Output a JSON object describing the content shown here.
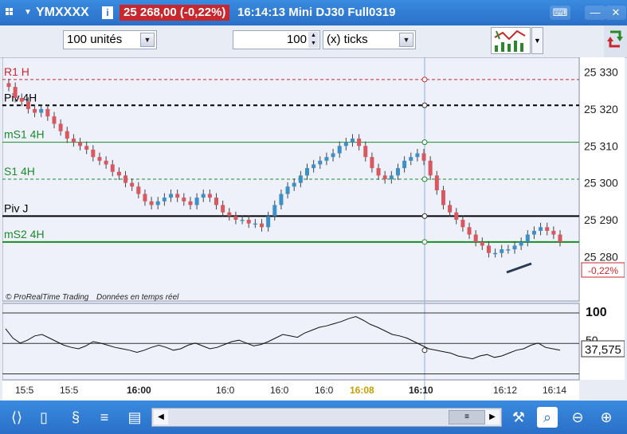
{
  "window": {
    "symbol": "YMXXXX",
    "price_badge": "25 268,00 (-0,22%)",
    "subtitle": "16:14:13 Mini DJ30 Full0319",
    "info_glyph": "i"
  },
  "toolbar": {
    "units_select": "100 unités",
    "ticks_value": "100",
    "ticks_unit_select": "(x) ticks"
  },
  "chart": {
    "levels": {
      "r1": "R1 H",
      "piv4": "Piv 4H",
      "ms1": "mS1 4H",
      "s1": "S1 4H",
      "pivj": "Piv J",
      "ms2": "mS2 4H"
    },
    "price_ticks": [
      "25 330",
      "25 320",
      "25 310",
      "25 300",
      "25 290",
      "25 280"
    ],
    "current_price_tag": "-0,22%",
    "credit_brand": "© ProRealTime Trading",
    "credit_note": "Données en temps réel",
    "indicator_top_label": "100",
    "indicator_mid_label": "50",
    "indicator_value": "37,575",
    "time_ticks": [
      "15:5",
      "15:5",
      "16:00",
      "16:0",
      "16:0",
      "16:0",
      "16:08",
      "16:10",
      "16:12",
      "16:14"
    ]
  },
  "colors": {
    "bull": "#3d8fc7",
    "bear": "#d9575e",
    "red_level": "#c8282d",
    "green_level": "#1a8a2a",
    "accent": "#2a6fc8"
  },
  "chart_data": {
    "type": "candlestick",
    "ylim": [
      25268,
      25334
    ],
    "price_ticks": [
      25330,
      25320,
      25310,
      25300,
      25290,
      25280
    ],
    "levels": [
      {
        "name": "R1 H",
        "value": 25328
      },
      {
        "name": "Piv 4H",
        "value": 25321
      },
      {
        "name": "mS1 4H",
        "value": 25311
      },
      {
        "name": "S1 4H",
        "value": 25301
      },
      {
        "name": "Piv J",
        "value": 25291
      },
      {
        "name": "mS2 4H",
        "value": 25284
      }
    ],
    "close_series": [
      25326,
      25323,
      25322,
      25320,
      25319,
      25320,
      25318,
      25316,
      25314,
      25312,
      25311,
      25310,
      25309,
      25307,
      25306,
      25305,
      25303,
      25302,
      25300,
      25299,
      25297,
      25295,
      25294,
      25295,
      25296,
      25297,
      25296,
      25295,
      25294,
      25296,
      25297,
      25296,
      25294,
      25292,
      25291,
      25290,
      25290,
      25289,
      25289,
      25288,
      25291,
      25294,
      25297,
      25299,
      25300,
      25302,
      25304,
      25305,
      25306,
      25307,
      25308,
      25310,
      25311,
      25312,
      25310,
      25307,
      25304,
      25302,
      25301,
      25302,
      25304,
      25306,
      25307,
      25308,
      25306,
      25302,
      25298,
      25294,
      25292,
      25290,
      25288,
      25286,
      25284,
      25283,
      25281,
      25281,
      25282,
      25282,
      25283,
      25284,
      25286,
      25287,
      25288,
      25287,
      25286,
      25284
    ],
    "indicator": {
      "name": "",
      "ylim": [
        0,
        100
      ],
      "last": 37.575,
      "values": [
        68,
        55,
        48,
        52,
        58,
        60,
        55,
        50,
        45,
        42,
        40,
        44,
        50,
        48,
        45,
        42,
        40,
        38,
        35,
        38,
        42,
        45,
        42,
        38,
        40,
        45,
        48,
        44,
        40,
        42,
        46,
        50,
        52,
        48,
        44,
        46,
        50,
        55,
        60,
        58,
        56,
        62,
        66,
        70,
        72,
        75,
        78,
        82,
        85,
        80,
        74,
        70,
        65,
        60,
        58,
        55,
        50,
        45,
        40,
        38,
        36,
        34,
        30,
        28,
        26,
        30,
        32,
        28,
        30,
        34,
        38,
        40,
        45,
        48,
        42,
        40,
        38
      ]
    }
  }
}
